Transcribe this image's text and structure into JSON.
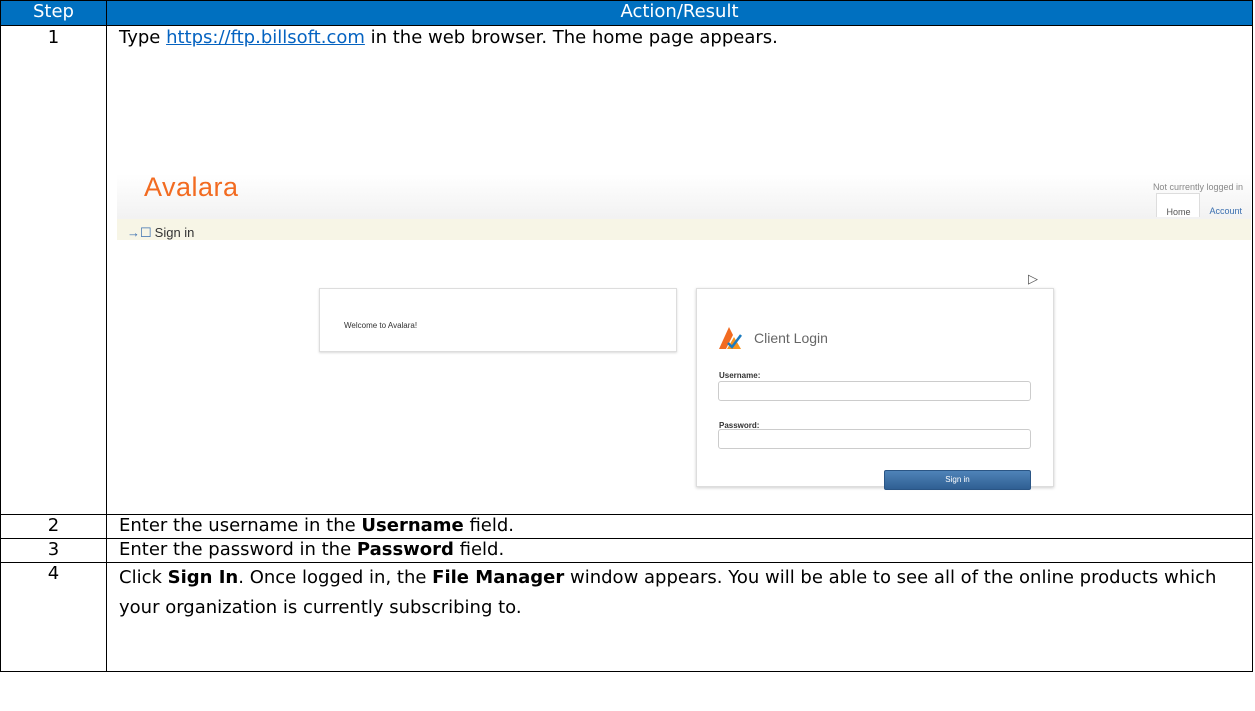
{
  "table": {
    "header": {
      "step": "Step",
      "action": "Action/Result"
    },
    "rows": [
      {
        "step": "1",
        "text_before": "Type ",
        "link": "https://ftp.billsoft.com",
        "text_after": " in the web browser.  The home page appears."
      },
      {
        "step": "2",
        "text_before": "Enter the username in the ",
        "bold": "Username",
        "text_after": " field."
      },
      {
        "step": "3",
        "text_before": "Enter the password in the ",
        "bold": "Password",
        "text_after": " field."
      },
      {
        "step": "4",
        "text_a": "Click ",
        "bold_a": "Sign In",
        "text_b": ".  Once logged in, the ",
        "bold_b": "File Manager",
        "text_c": " window appears.  You will be able to see all of the online products which your organization is currently subscribing to."
      }
    ]
  },
  "screenshot": {
    "logo": "Avalara",
    "status": "Not currently logged in",
    "nav": {
      "home": "Home",
      "account": "Account"
    },
    "signin_bar": "Sign in",
    "welcome": "Welcome to Avalara!",
    "login": {
      "title": "Client Login",
      "username_label": "Username:",
      "password_label": "Password:",
      "button": "Sign in"
    }
  },
  "colors": {
    "header_bg": "#0070c0",
    "link": "#0563c1",
    "brand_orange": "#f26b21",
    "button_blue": "#2f5f93"
  }
}
